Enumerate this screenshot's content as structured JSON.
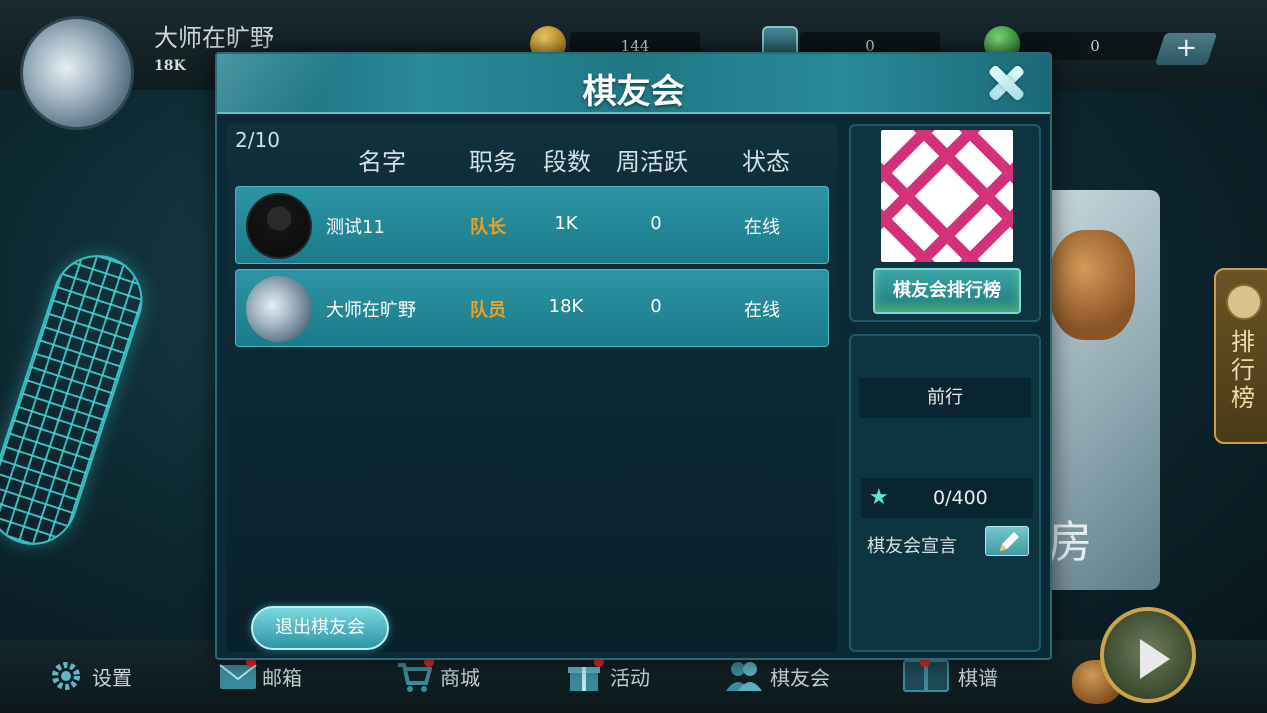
{
  "top_bar": {
    "player_name": "大师在旷野",
    "player_rank": "18K",
    "coins": "144",
    "shield_value": "0",
    "gem_value": "0",
    "plus_label": "+"
  },
  "side_tab": {
    "label": "排行榜",
    "partial_card_text": "房"
  },
  "dialog": {
    "title": "棋友会",
    "member_count": "2/10",
    "columns": [
      "名字",
      "职务",
      "段数",
      "周活跃",
      "状态"
    ],
    "members": [
      {
        "name": "测试11",
        "role": "队长",
        "rank": "1K",
        "weekly_active": "0",
        "status": "在线"
      },
      {
        "name": "大师在旷野",
        "role": "队员",
        "rank": "18K",
        "weekly_active": "0",
        "status": "在线"
      }
    ],
    "exit_button": "退出棋友会",
    "ranking_button": "棋友会排行榜",
    "notice_text": "前行",
    "progress": "0/400",
    "declaration_label": "棋友会宣言"
  },
  "bottom_nav": {
    "items": [
      "设置",
      "邮箱",
      "商城",
      "活动",
      "棋友会",
      "棋谱"
    ]
  },
  "colors": {
    "role_accent": "#f0a020",
    "row_bg": "#2d95a3",
    "emblem_pink": "#d4317a"
  }
}
